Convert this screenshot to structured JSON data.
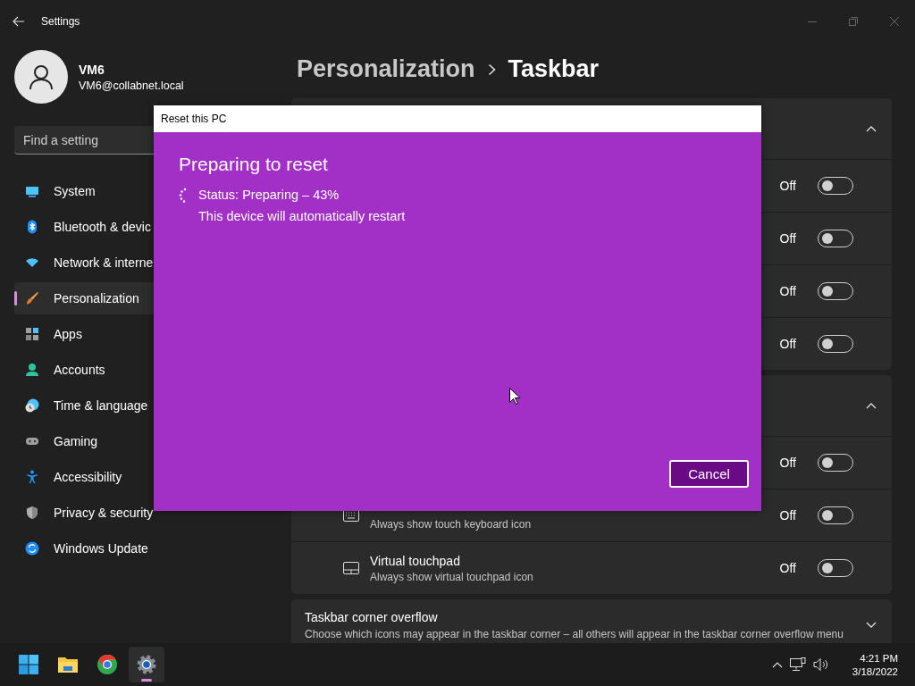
{
  "window": {
    "title": "Settings"
  },
  "user": {
    "name": "VM6",
    "email": "VM6@collabnet.local"
  },
  "search": {
    "placeholder": "Find a setting"
  },
  "nav": [
    {
      "label": "System",
      "selected": false
    },
    {
      "label": "Bluetooth & devic",
      "selected": false
    },
    {
      "label": "Network & interne",
      "selected": false
    },
    {
      "label": "Personalization",
      "selected": true
    },
    {
      "label": "Apps",
      "selected": false
    },
    {
      "label": "Accounts",
      "selected": false
    },
    {
      "label": "Time & language",
      "selected": false
    },
    {
      "label": "Gaming",
      "selected": false
    },
    {
      "label": "Accessibility",
      "selected": false
    },
    {
      "label": "Privacy & security",
      "selected": false
    },
    {
      "label": "Windows Update",
      "selected": false
    }
  ],
  "breadcrumb": {
    "parent": "Personalization",
    "current": "Taskbar"
  },
  "sections": [
    {
      "expanded": true,
      "rows": [
        {
          "state_label": "Off",
          "on": false
        },
        {
          "state_label": "Off",
          "on": false
        },
        {
          "state_label": "Off",
          "on": false
        },
        {
          "state_label": "Off",
          "on": false
        }
      ]
    },
    {
      "expanded": true,
      "rows": [
        {
          "state_label": "Off",
          "on": false
        },
        {
          "subtitle": "Always show touch keyboard icon",
          "state_label": "Off",
          "on": false
        },
        {
          "title": "Virtual touchpad",
          "subtitle": "Always show virtual touchpad icon",
          "state_label": "Off",
          "on": false
        }
      ]
    },
    {
      "expanded": false,
      "title": "Taskbar corner overflow",
      "subtitle": "Choose which icons may appear in the taskbar corner – all others will appear in the taskbar corner overflow menu"
    }
  ],
  "dialog": {
    "title": "Reset this PC",
    "heading": "Preparing to reset",
    "status": "Status: Preparing – 43%",
    "note": "This device will automatically restart",
    "cancel": "Cancel"
  },
  "taskbar": {
    "apps": [
      {
        "selected": false
      },
      {
        "selected": false
      },
      {
        "selected": false
      },
      {
        "selected": true
      }
    ],
    "time": "4:21 PM",
    "date": "3/18/2022"
  }
}
